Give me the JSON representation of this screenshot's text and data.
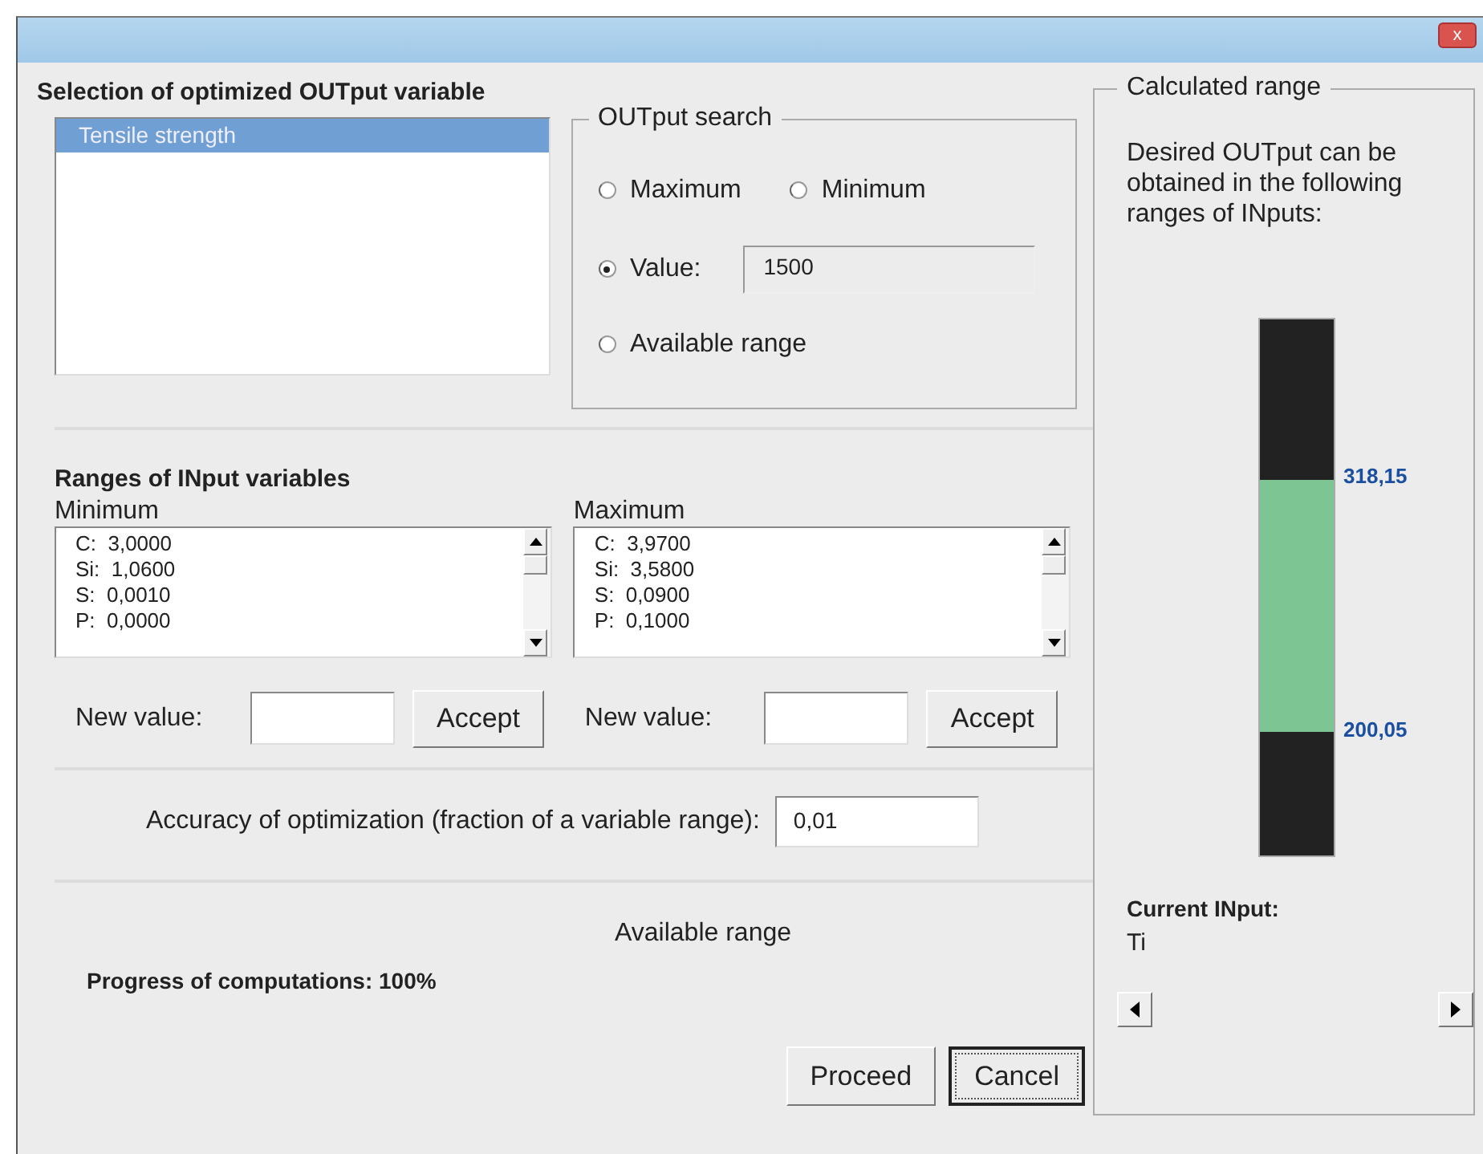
{
  "window": {
    "close": "x"
  },
  "output_selection": {
    "heading": "Selection of optimized OUTput variable",
    "items": [
      {
        "label": "Tensile strength",
        "selected": true
      }
    ]
  },
  "output_search": {
    "title": "OUTput search",
    "options": [
      {
        "label": "Maximum",
        "selected": false
      },
      {
        "label": "Minimum",
        "selected": false
      },
      {
        "label": "Value:",
        "selected": true
      },
      {
        "label": "Available range",
        "selected": false
      }
    ],
    "value": "1500"
  },
  "input_ranges": {
    "heading": "Ranges of INput variables",
    "lists": [
      {
        "label": "Minimum",
        "items": [
          "C:  3,0000",
          "Si:  1,0600",
          "S:  0,0010",
          "P:  0,0000"
        ],
        "new_value_label": "New value:",
        "accept": "Accept"
      },
      {
        "label": "Maximum",
        "items": [
          "C:  3,9700",
          "Si:  3,5800",
          "S:  0,0900",
          "P:  0,1000"
        ],
        "new_value_label": "New value:",
        "accept": "Accept"
      }
    ]
  },
  "accuracy": {
    "label": "Accuracy of optimization (fraction of a variable range):",
    "value": "0,01"
  },
  "status": {
    "mode": "Available range",
    "progress": "Progress of computations: 100%"
  },
  "buttons": [
    {
      "label": "Proceed",
      "focused": false
    },
    {
      "label": "Cancel",
      "focused": true
    }
  ],
  "calculated_range": {
    "title": "Calculated range",
    "description": "Desired OUTput can be obtained in the following ranges of INputs:",
    "segments": [
      {
        "kind": "excluded",
        "level": 0.3
      },
      {
        "kind": "allowed",
        "level": 0.47
      },
      {
        "kind": "excluded",
        "level": 0.23
      }
    ],
    "upper_label": "318,15",
    "lower_label": "200,05",
    "current_label": "Current INput:",
    "current_value": "Ti"
  }
}
